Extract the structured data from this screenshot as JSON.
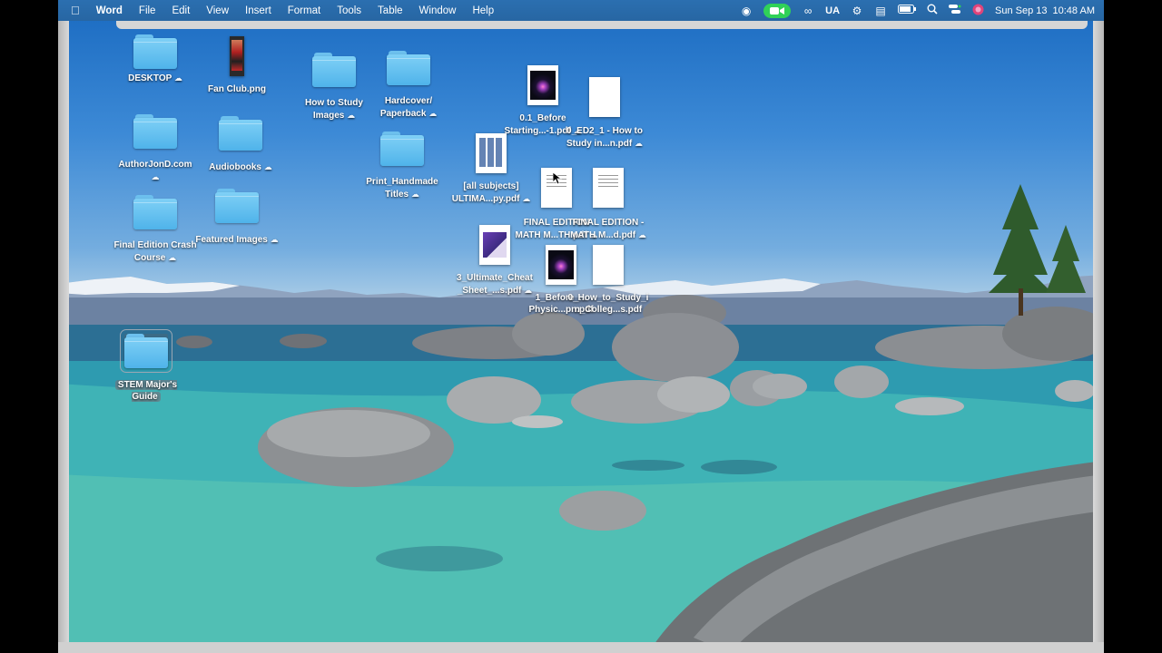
{
  "menubar": {
    "app_name": "Word",
    "items": [
      "File",
      "Edit",
      "View",
      "Insert",
      "Format",
      "Tools",
      "Table",
      "Window",
      "Help"
    ],
    "status": {
      "input_source": "UA",
      "date": "Sun Sep 13",
      "time": "10:48 AM"
    }
  },
  "desktop_icons": [
    {
      "id": "desktop",
      "label": "DESKTOP",
      "kind": "folder",
      "cloud": true
    },
    {
      "id": "fan-club",
      "label": "Fan Club.png",
      "kind": "fan",
      "cloud": false
    },
    {
      "id": "how-to-study-images",
      "label": "How to Study Images",
      "kind": "folder",
      "cloud": true
    },
    {
      "id": "hardcover",
      "label": "Hardcover/ Paperback",
      "kind": "folder",
      "cloud": true
    },
    {
      "id": "before-starting",
      "label": "0.1_Before Starting...-1.pdf",
      "kind": "dark",
      "cloud": true
    },
    {
      "id": "ed2-how-to-study",
      "label": "0_ED2_1 - How to Study in...n.pdf",
      "kind": "blank",
      "cloud": true
    },
    {
      "id": "authorjond",
      "label": "AuthorJonD.com",
      "kind": "folder",
      "cloud": true
    },
    {
      "id": "audiobooks",
      "label": "Audiobooks",
      "kind": "folder",
      "cloud": true
    },
    {
      "id": "print-handmade",
      "label": "Print_Handmade Titles",
      "kind": "folder",
      "cloud": true
    },
    {
      "id": "all-subjects",
      "label": "[all subjects] ULTIMA...py.pdf",
      "kind": "grid",
      "cloud": true
    },
    {
      "id": "final-math",
      "label": "FINAL EDITION MATH M...TH.pdf",
      "kind": "lines",
      "cloud": true
    },
    {
      "id": "final-math-d",
      "label": "FINAL EDITION - MATH M...d.pdf",
      "kind": "lines",
      "cloud": true
    },
    {
      "id": "final-crash",
      "label": "Final Edition Crash Course",
      "kind": "folder",
      "cloud": true
    },
    {
      "id": "featured",
      "label": "Featured Images",
      "kind": "folder",
      "cloud": true
    },
    {
      "id": "ultimate-cheat",
      "label": "3_Ultimate_Cheat _Sheet_...s.pdf",
      "kind": "purple",
      "cloud": true
    },
    {
      "id": "before-physics",
      "label": "1_Before_... Physic...pn.pdf",
      "kind": "dark",
      "cloud": false
    },
    {
      "id": "how-to-study-college",
      "label": "0_How_to_Study_i n_Colleg...s.pdf",
      "kind": "blank",
      "cloud": false
    },
    {
      "id": "stem-guide",
      "label": "STEM Major's Guide",
      "kind": "folder",
      "cloud": false,
      "selected": true
    }
  ]
}
